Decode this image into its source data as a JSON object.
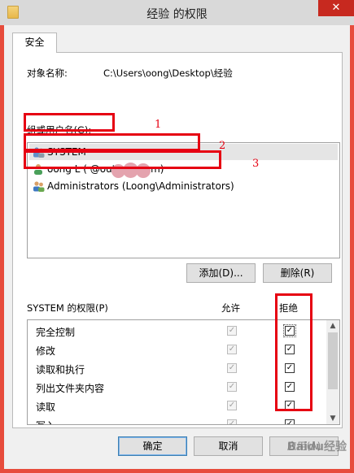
{
  "window": {
    "title": "经验 的权限",
    "close_glyph": "✕"
  },
  "tab": {
    "label": "安全"
  },
  "object": {
    "label": "对象名称:",
    "value": "C:\\Users\\oong\\Desktop\\经验"
  },
  "groups": {
    "label": "组或用户名(G):",
    "items": [
      {
        "label": "SYSTEM",
        "icon": "users-group-icon"
      },
      {
        "label": "oong L (            @outlook.com)",
        "icon": "user-icon"
      },
      {
        "label": "Administrators (Loong\\Administrators)",
        "icon": "users-group-icon"
      }
    ]
  },
  "buttons": {
    "add": "添加(D)...",
    "remove": "删除(R)"
  },
  "permissions": {
    "label": "SYSTEM 的权限(P)",
    "allow_header": "允许",
    "deny_header": "拒绝",
    "rows": [
      {
        "label": "完全控制",
        "allow": true,
        "deny": true
      },
      {
        "label": "修改",
        "allow": true,
        "deny": true
      },
      {
        "label": "读取和执行",
        "allow": true,
        "deny": true
      },
      {
        "label": "列出文件夹内容",
        "allow": true,
        "deny": true
      },
      {
        "label": "读取",
        "allow": true,
        "deny": true
      },
      {
        "label": "写入",
        "allow": true,
        "deny": true
      }
    ]
  },
  "footer": {
    "ok": "确定",
    "cancel": "取消",
    "apply": "应用(A)"
  },
  "annotations": [
    "1",
    "2",
    "3"
  ],
  "watermark": "Baidu经验",
  "colors": {
    "annotation_red": "#e60012",
    "close_red": "#c7291f"
  }
}
